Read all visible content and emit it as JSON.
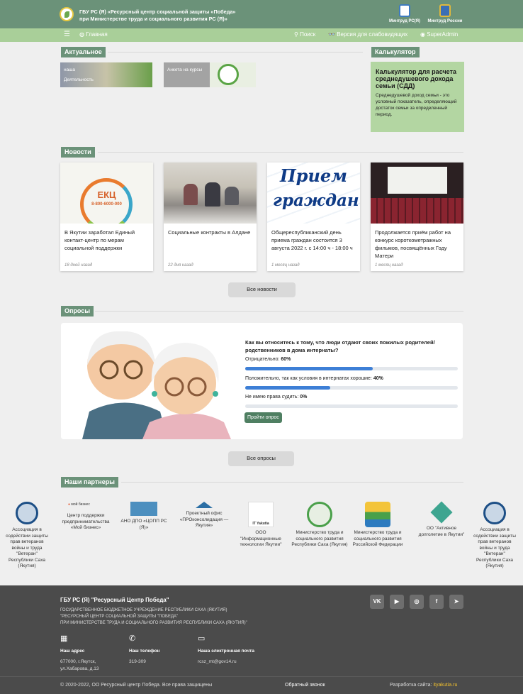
{
  "header": {
    "org_line1": "ГБУ РС (Я) «Ресурсный центр социальной защиты «Победа»",
    "org_line2": "при Министерстве труда и социального развития РС (Я)»",
    "ministry1": "Минтруд РС(Я)",
    "ministry2": "Минтруд России"
  },
  "nav": {
    "home": "Главная",
    "search": "Поиск",
    "low_vision": "Версия для слабовидящих",
    "user": "SuperAdmin"
  },
  "actual": {
    "title": "Актуальное",
    "items": [
      {
        "label1": "наша",
        "label2": "Деятельность"
      },
      {
        "label1": "Анкета на курсы",
        "label2": ""
      }
    ]
  },
  "calculator": {
    "title": "Калькулятор",
    "heading": "Калькулятор для расчета среднедушевого дохода семьи (СДД)",
    "text": "Среднедушевой доход семьи - это условный показатель, определяющий достаток семьи за определенный период."
  },
  "news": {
    "title": "Новости",
    "all": "Все новости",
    "items": [
      {
        "title": "В Якутии заработал Единый контакт-центр по мерам социальной поддержки",
        "date": "18 дней назад",
        "img_text": "ЕКЦ",
        "img_phone": "8-800-6000-000"
      },
      {
        "title": "Социальные контракты в Алдане",
        "date": "22 дня назад"
      },
      {
        "title": "Общереспубликанский день приема граждан состоится 3 августа 2022 г. с 14:00 ч - 18:00 ч",
        "date": "1 месяц назад",
        "img_line1": "Прием",
        "img_line2": "граждан"
      },
      {
        "title": "Продолжается приём работ на конкурс короткометражных фильмов, посвящённых Году Матери",
        "date": "1 месяц назад"
      }
    ]
  },
  "polls": {
    "title": "Опросы",
    "question": "Как вы относитесь к тому, что люди отдают своих пожилых родителей/родственников в дома интернаты?",
    "options": [
      {
        "label": "Отрицательно:",
        "value": "60%",
        "fraction": 0.6
      },
      {
        "label": "Положительно, так как условия в интернатах хорошие:",
        "value": "40%",
        "fraction": 0.4
      },
      {
        "label": "Не имею права судить:",
        "value": "0%",
        "fraction": 0
      }
    ],
    "button": "Пройти опрос",
    "all": "Все опросы"
  },
  "partners": {
    "title": "Наши партнеры",
    "items": [
      "Ассоциация в содействии защиты прав ветеранов войны и труда \"Ветеран\" Республики Саха (Якутия)",
      "Центр поддержки предпринимательства «Мой бизнес»",
      "АНО ДПО «ЦОПП РС (Я)»",
      "Проектный офис «ПРОконсолидация — Якутия»",
      "ООО \"Информационные технологии Якутии\"",
      "Министерство труда и социального развития Республики Саха (Якутия)",
      "Министерство труда и социального развития Российской Федерации",
      "ОО \"Активное долголетие в Якутии\"",
      "Ассоциация в содействии защиты прав ветеранов войны и труда \"Ветеран\" Республики Саха (Якутия)"
    ],
    "logo_texts": {
      "moibiz": "мой бизнес",
      "itya": "IT Yakutia"
    }
  },
  "footer": {
    "name": "ГБУ РС (Я) \"Ресурсный Центр Победа\"",
    "sub1": "ГОСУДАРСТВЕННОЕ БЮДЖЕТНОЕ УЧРЕЖДЕНИЕ РЕСПУБЛИКИ САХА (ЯКУТИЯ)",
    "sub2": "\"РЕСУРСНЫЙ ЦЕНТР СОЦИАЛЬНОЙ ЗАЩИТЫ \"ПОБЕДА\"",
    "sub3": "ПРИ МИНИСТЕРСТВЕ ТРУДА И СОЦИАЛЬНОГО РАЗВИТИЯ РЕСПУБЛИКИ САХА (ЯКУТИЯ)\"",
    "address_label": "Наш адрес",
    "address1": "677000, г.Якутск,",
    "address2": "ул.Хабарова, д.13",
    "phone_label": "Наш телефон",
    "phone": "319-309",
    "email_label": "Наша электронная почта",
    "email": "rcsz_mt@gov14.ru",
    "copyright": "© 2020-2022, ОО Ресурсный центр Победа. Все права защищены",
    "callback": "Обратный звонок",
    "dev_label": "Разработка сайта:",
    "dev_link": "ityakutia.ru",
    "social": {
      "vk": "VK",
      "youtube": "▶",
      "instagram": "◎",
      "facebook": "f",
      "telegram": "➤"
    }
  },
  "colors": {
    "header": "#6b9279",
    "nav": "#a9cf99",
    "accent": "#f2c12e"
  }
}
